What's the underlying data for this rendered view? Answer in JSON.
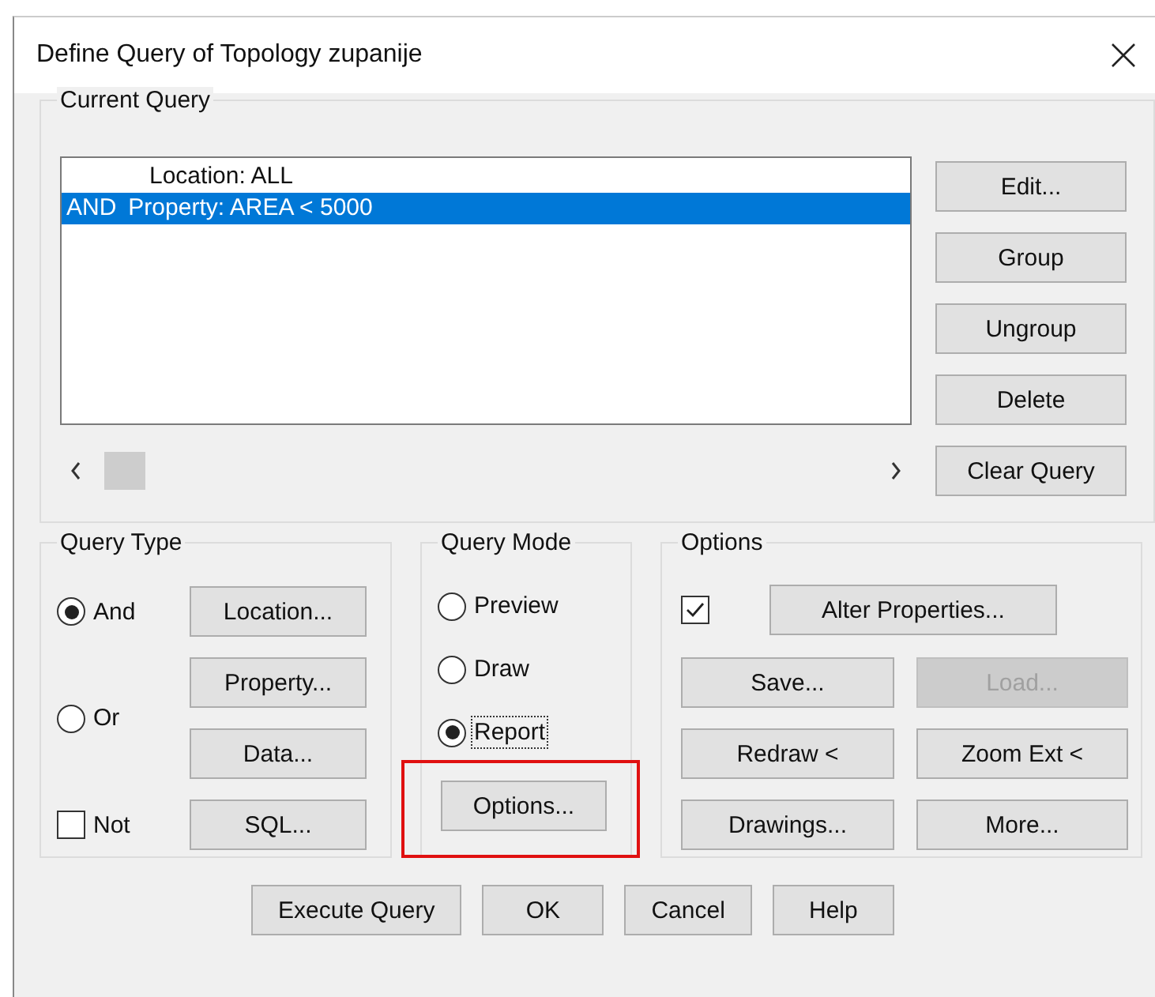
{
  "window": {
    "title": "Define Query of Topology zupanije"
  },
  "current_query": {
    "label": "Current Query",
    "rows": [
      {
        "condition": "Location: ALL",
        "selected": false
      },
      {
        "operator": "AND",
        "condition": "Property: AREA < 5000",
        "selected": true
      }
    ],
    "buttons": [
      "Edit...",
      "Group",
      "Ungroup",
      "Delete",
      "Clear Query"
    ]
  },
  "query_type": {
    "label": "Query Type",
    "radios": [
      {
        "label": "And",
        "selected": true
      },
      {
        "label": "Or",
        "selected": false
      }
    ],
    "not_checkbox": {
      "label": "Not",
      "checked": false
    },
    "buttons": [
      "Location...",
      "Property...",
      "Data...",
      "SQL..."
    ]
  },
  "query_mode": {
    "label": "Query Mode",
    "radios": [
      {
        "label": "Preview",
        "selected": false
      },
      {
        "label": "Draw",
        "selected": false
      },
      {
        "label": "Report",
        "selected": true
      }
    ],
    "options_button": {
      "label": "Options...",
      "highlighted": true
    }
  },
  "options": {
    "label": "Options",
    "checkbox": {
      "checked": true
    },
    "alter_button": {
      "label": "Alter Properties...",
      "disabled": false
    },
    "buttons": [
      {
        "label": "Save...",
        "disabled": false
      },
      {
        "label": "Load...",
        "disabled": true
      },
      {
        "label": "Redraw <",
        "disabled": false
      },
      {
        "label": "Zoom Ext <",
        "disabled": false
      },
      {
        "label": "Drawings...",
        "disabled": false
      },
      {
        "label": "More...",
        "disabled": false
      }
    ]
  },
  "buttons": [
    "Execute Query",
    "OK",
    "Cancel",
    "Help"
  ]
}
